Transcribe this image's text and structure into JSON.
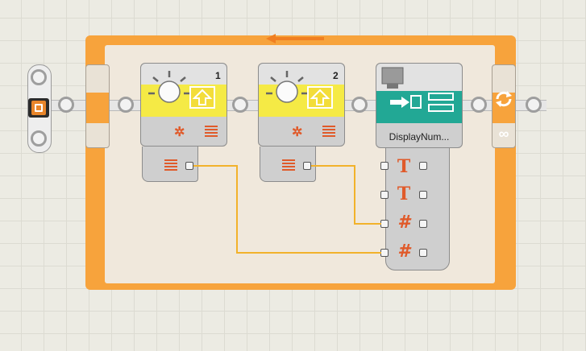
{
  "canvas": {
    "background": "#ecebe3",
    "grid_color": "#dcdbd2"
  },
  "colors": {
    "loop": "#f7a33c",
    "sensor": "#f5ea45",
    "display": "#22a895",
    "wire": "#f2b22b",
    "plug": "#e05a2a"
  },
  "blocks": [
    {
      "type": "light-sensor",
      "number": "1",
      "icon": "sun-icon"
    },
    {
      "type": "light-sensor",
      "number": "2",
      "icon": "sun-icon"
    },
    {
      "type": "display",
      "label": "DisplayNum...",
      "icon": "display-icon"
    }
  ],
  "display_inputs": [
    "T",
    "T",
    "#",
    "#"
  ],
  "loop": {
    "symbol": "∞",
    "icon": "loop-icon"
  },
  "start": {
    "icon": "start-icon"
  }
}
